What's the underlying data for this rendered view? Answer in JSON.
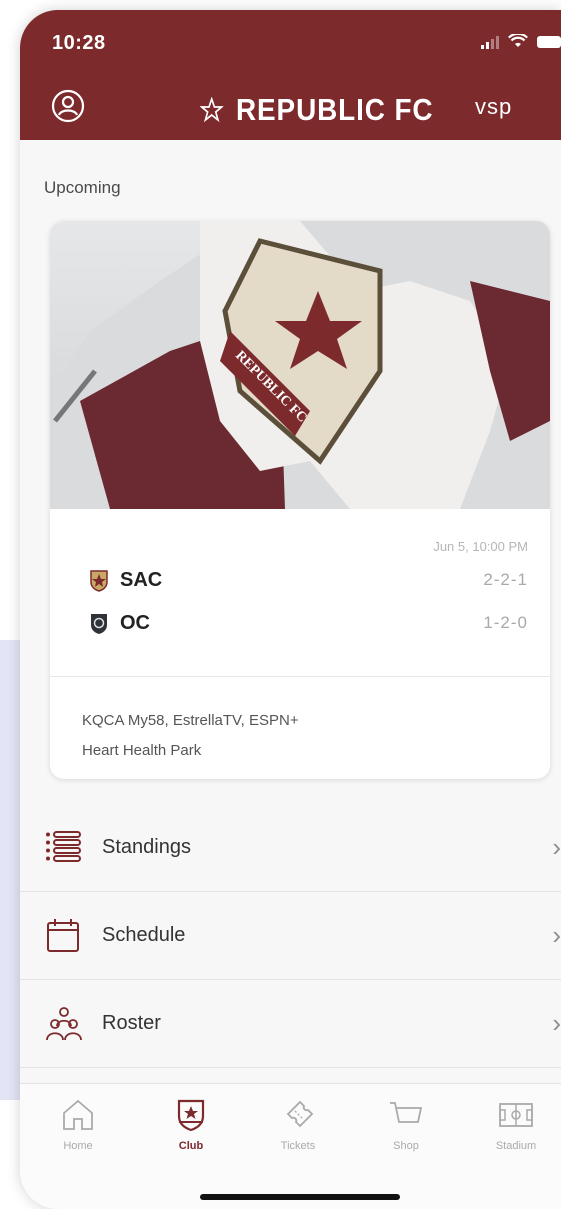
{
  "status_bar": {
    "time": "10:28"
  },
  "header": {
    "title": "REPUBLIC FC",
    "sponsor": "vsp"
  },
  "section": {
    "upcoming_label": "Upcoming"
  },
  "match": {
    "date": "Jun 5, 10:00 PM",
    "home": {
      "abbr": "SAC",
      "record": "2-2-1"
    },
    "away": {
      "abbr": "OC",
      "record": "1-2-0"
    },
    "broadcast": "KQCA My58, EstrellaTV, ESPN+",
    "venue": "Heart Health Park",
    "hero_flag_text": "REPUBLIC FC"
  },
  "menu": [
    {
      "label": "Standings",
      "icon": "list-icon"
    },
    {
      "label": "Schedule",
      "icon": "calendar-icon"
    },
    {
      "label": "Roster",
      "icon": "people-icon"
    }
  ],
  "tabs": [
    {
      "label": "Home",
      "icon": "home-icon",
      "active": false
    },
    {
      "label": "Club",
      "icon": "shield-icon",
      "active": true
    },
    {
      "label": "Tickets",
      "icon": "ticket-icon",
      "active": false
    },
    {
      "label": "Shop",
      "icon": "cart-icon",
      "active": false
    },
    {
      "label": "Stadium",
      "icon": "stadium-icon",
      "active": false
    }
  ],
  "colors": {
    "brand": "#7d2a2d",
    "background": "#f7f7f7",
    "accent_bg": "#e3e5f6"
  }
}
